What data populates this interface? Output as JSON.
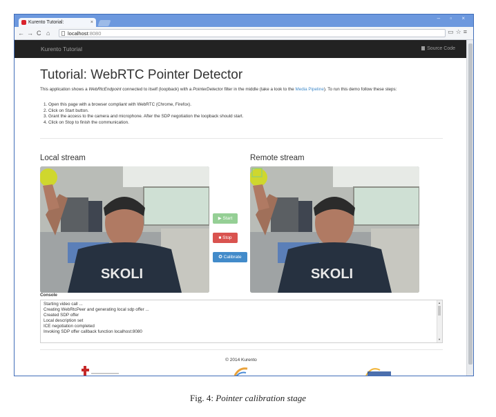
{
  "browser": {
    "tab_title": "Kurento Tutorial:",
    "tab_close": "×",
    "url_host": "localhost",
    "url_port": ":8080",
    "window_controls": "– ▫ ×"
  },
  "navbar": {
    "brand": "Kurento Tutorial",
    "source_code": "Source Code"
  },
  "page": {
    "title": "Tutorial: WebRTC Pointer Detector",
    "intro_before": "This application shows a ",
    "intro_ep1": "WebRtcEndpoint",
    "intro_mid": " connected to itself (loopback) with a ",
    "intro_ep2": "PointerDetector",
    "intro_mid2": " filter in the middle (take a look to the ",
    "intro_link": "Media Pipeline",
    "intro_after": "). To run this demo follow these steps:",
    "steps": [
      "Open this page with a browser compliant with WebRTC (Chrome, Firefox).",
      "Click on Start button.",
      "Grant the access to the camera and microphone. After the SDP negotiation the loopback should start.",
      "Click on Stop to finish the communication."
    ],
    "local_heading": "Local stream",
    "remote_heading": "Remote stream",
    "buttons": {
      "start": "Start",
      "stop": "Stop",
      "calibrate": "Calibrate"
    },
    "console_label": "Console",
    "console_lines": [
      "Starting video call ...",
      "Creating WebRtcPeer and generating local sdp offer ...",
      "Created SDP offer",
      "Local description set",
      "ICE negotiation completed",
      "Invoking SDP offer callback function localhost:8080"
    ],
    "footer": "© 2014 Kurento"
  },
  "caption": {
    "prefix": "Fig. 4: ",
    "text": "Pointer calibration stage"
  }
}
